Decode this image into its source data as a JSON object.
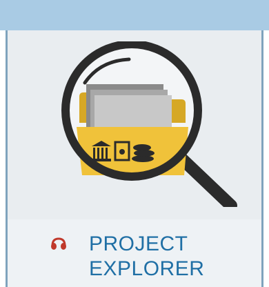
{
  "tile": {
    "label_line1": "PROJECT",
    "label_line2": "EXPLORER",
    "image_icon": "magnifier-folder-icon",
    "label_icon": "headphones-icon"
  },
  "colors": {
    "header_bar": "#a9cbe4",
    "tile_background": "#e9edf0",
    "label_text": "#1f6fa5",
    "label_icon": "#c0392b",
    "folder": "#f0c23a",
    "magnifier": "#2b2b2b"
  }
}
